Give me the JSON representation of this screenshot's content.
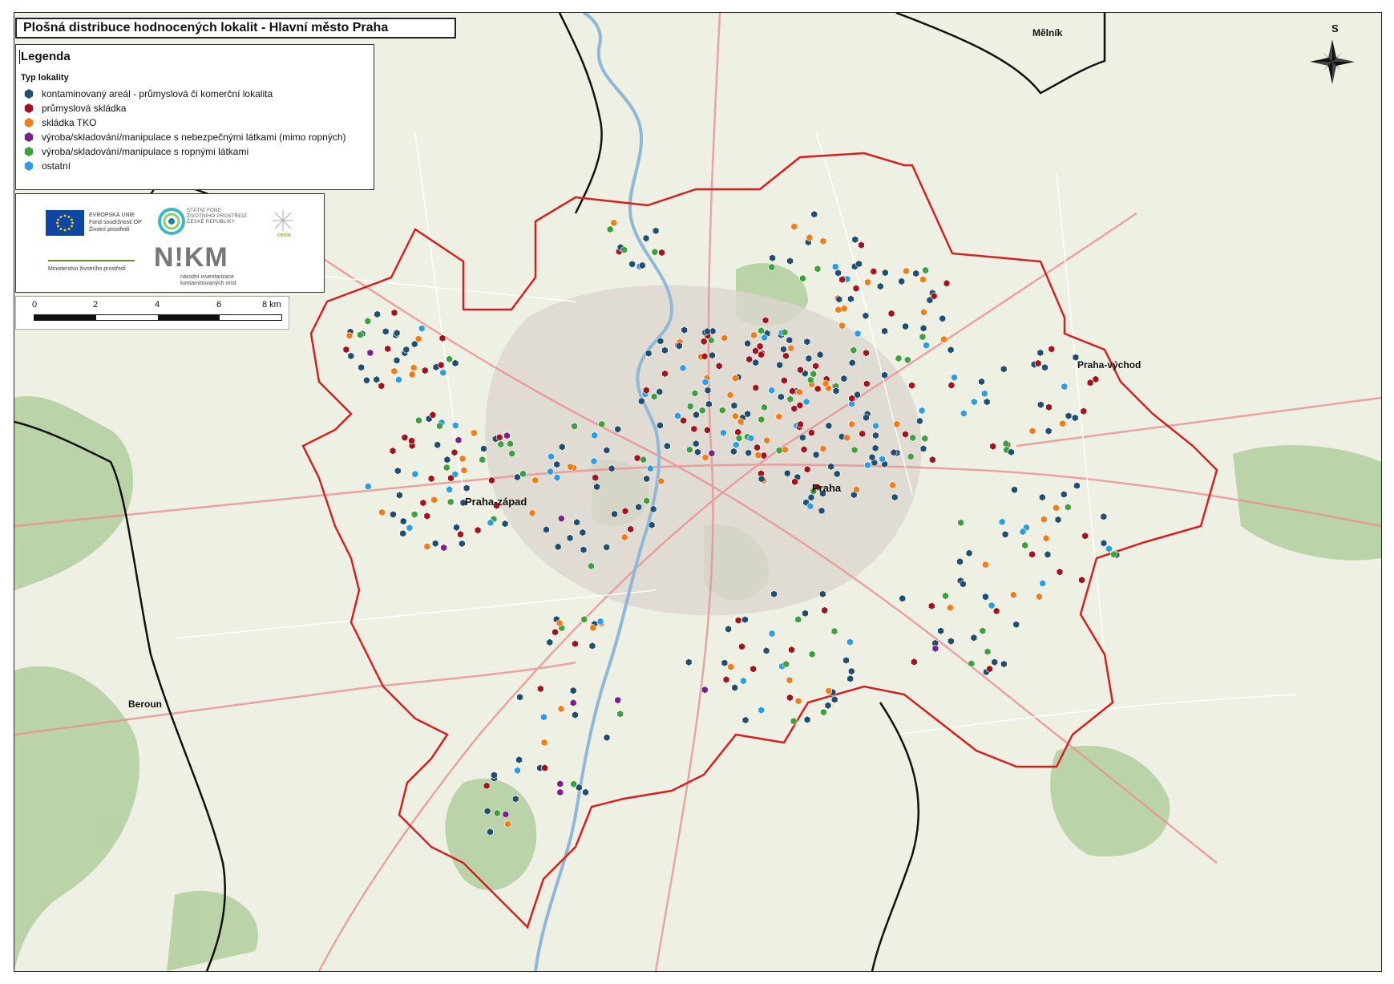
{
  "title": "Plošná distribuce hodnocených lokalit - Hlavní město Praha",
  "legend": {
    "title": "Legenda",
    "subtitle": "Typ lokality",
    "items": [
      {
        "label": "kontaminovaný areál - průmyslová či komerční lokalita",
        "color": "#1f4e6e"
      },
      {
        "label": "průmyslová skládka",
        "color": "#a0141e"
      },
      {
        "label": "skládka TKO",
        "color": "#f07d1a"
      },
      {
        "label": "výroba/skladování/manipulace s nebezpečnými látkami (mimo ropných)",
        "color": "#7a1f8c"
      },
      {
        "label": "výroba/skladování/manipulace s ropnými látkami",
        "color": "#3ca03c"
      },
      {
        "label": "ostatní",
        "color": "#2b9de0"
      }
    ]
  },
  "logos": {
    "eu_text": "EVROPSKÁ UNIE Fond soudržnosti OP Životní prostředí",
    "sfzp_text": "STÁTNÍ FOND ŽIVOTNÍHO PROSTŘEDÍ ČESKÉ REPUBLIKY",
    "cenia_text": "cenia",
    "mzp_text": "Ministerstvo životního prostředí",
    "nikm_text": "N!KM",
    "nikm_sub": "národní inventarizace kontaminovaných míst"
  },
  "scale": {
    "labels": [
      "0",
      "2",
      "4",
      "6",
      "8 km"
    ]
  },
  "north_label": "S",
  "places": {
    "melnik": "Mělník",
    "praha": "Praha",
    "praha_zapad": "Praha-západ",
    "praha_vychod": "Praha-východ",
    "beroun": "Beroun"
  },
  "colors": {
    "boundary_red": "#d62020",
    "boundary_black": "#111111",
    "river": "#8fb8d8",
    "forest": "#9ec38a",
    "urban": "#d8d4cc",
    "road_major": "#e88a8a"
  }
}
